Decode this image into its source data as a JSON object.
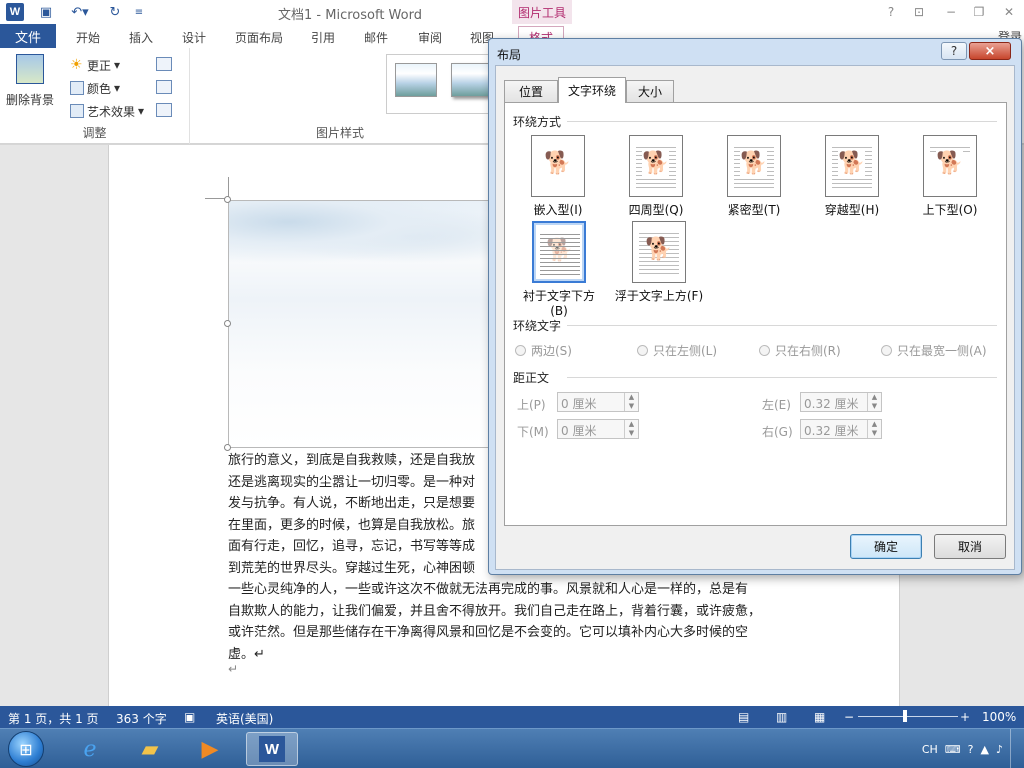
{
  "app": {
    "title": "文档1 - Microsoft Word",
    "context_tool": "图片工具",
    "logo_letter": "W",
    "signin": "登录",
    "icons": [
      "save-icon",
      "undo-icon",
      "redo-icon",
      "customize-icon",
      "help-icon",
      "ribbon-display-icon",
      "minimize-icon",
      "maximize-icon",
      "close-icon"
    ]
  },
  "ribbon": {
    "file_tab": "文件",
    "tabs": [
      "开始",
      "插入",
      "设计",
      "页面布局",
      "引用",
      "邮件",
      "审阅",
      "视图"
    ],
    "format_tab": "格式",
    "adjust": {
      "remove_bg": "删除背景",
      "corrections": "更正",
      "color": "颜色",
      "artistic": "艺术效果",
      "label": "调整"
    },
    "styles_label": "图片样式"
  },
  "document": {
    "paragraph": [
      "旅行的意义，到底是自我救赎，还是自我放",
      "还是逃离现实的尘嚣让一切归零。是一种对",
      "发与抗争。有人说，不断地出走，只是想要",
      "在里面，更多的时候，也算是自我放松。旅",
      "面有行走，回忆，追寻，忘记，书写等等成",
      "到荒芜的世界尽头。穿越过生死，心神困顿",
      "一些心灵纯净的人，一些或许这次不做就无法再完成的事。风景就和人心是一样的，总是有",
      "自欺欺人的能力，让我们偏爱，并且舍不得放开。我们自己走在路上，背着行囊，或许疲惫，",
      "或许茫然。但是那些储存在干净离得风景和回忆是不会变的。它可以填补内心大多时候的空",
      "虚。↵"
    ],
    "pilcrow": "↵"
  },
  "status": {
    "page": "第 1 页，共 1 页",
    "words": "363 个字",
    "language": "英语(美国)",
    "zoom": "100%",
    "zoom_minus": "−",
    "zoom_plus": "+"
  },
  "taskbar": {
    "apps": [
      "internet-explorer",
      "file-explorer",
      "media-player",
      "word"
    ],
    "tray_lang": "CH"
  },
  "dialog": {
    "title": "布局",
    "help": "?",
    "close": "×",
    "tabs": [
      "位置",
      "文字环绕",
      "大小"
    ],
    "active_tab": "文字环绕",
    "wrap_section": "环绕方式",
    "wrap_options": [
      {
        "label": "嵌入型(I)"
      },
      {
        "label": "四周型(Q)"
      },
      {
        "label": "紧密型(T)"
      },
      {
        "label": "穿越型(H)"
      },
      {
        "label": "上下型(O)"
      },
      {
        "label": "衬于文字下方(B)"
      },
      {
        "label": "浮于文字上方(F)"
      }
    ],
    "selected_wrap": "衬于文字下方(B)",
    "wrap_text_section": "环绕文字",
    "wrap_text_options": [
      "两边(S)",
      "只在左侧(L)",
      "只在右侧(R)",
      "只在最宽一侧(A)"
    ],
    "distance_section": "距正文",
    "distance": {
      "top_label": "上(P)",
      "top_value": "0 厘米",
      "bottom_label": "下(M)",
      "bottom_value": "0 厘米",
      "left_label": "左(E)",
      "left_value": "0.32 厘米",
      "right_label": "右(G)",
      "right_value": "0.32 厘米"
    },
    "ok": "确定",
    "cancel": "取消"
  }
}
